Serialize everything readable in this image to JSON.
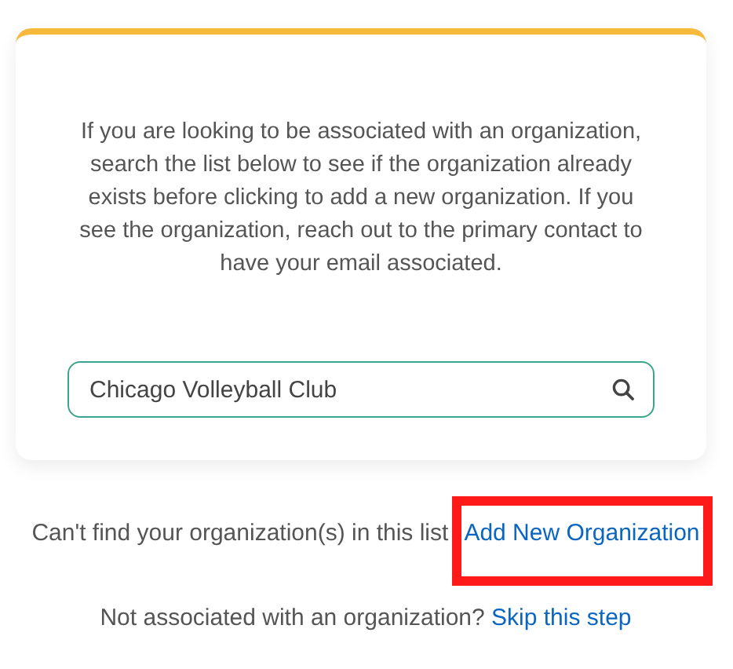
{
  "card": {
    "intro": "If you are looking to be associated with an organization, search the list below to see if the organization already exists before clicking to add a new organization. If you see the organization, reach out to the primary contact to have your email associated.",
    "search": {
      "value": "Chicago Volleyball Club"
    }
  },
  "add_prompt": {
    "text": "Can't find your organization(s) in this list",
    "link": "Add New Organization",
    "highlighted": true
  },
  "skip_prompt": {
    "text": "Not associated with an organization?",
    "link": "Skip this step"
  }
}
